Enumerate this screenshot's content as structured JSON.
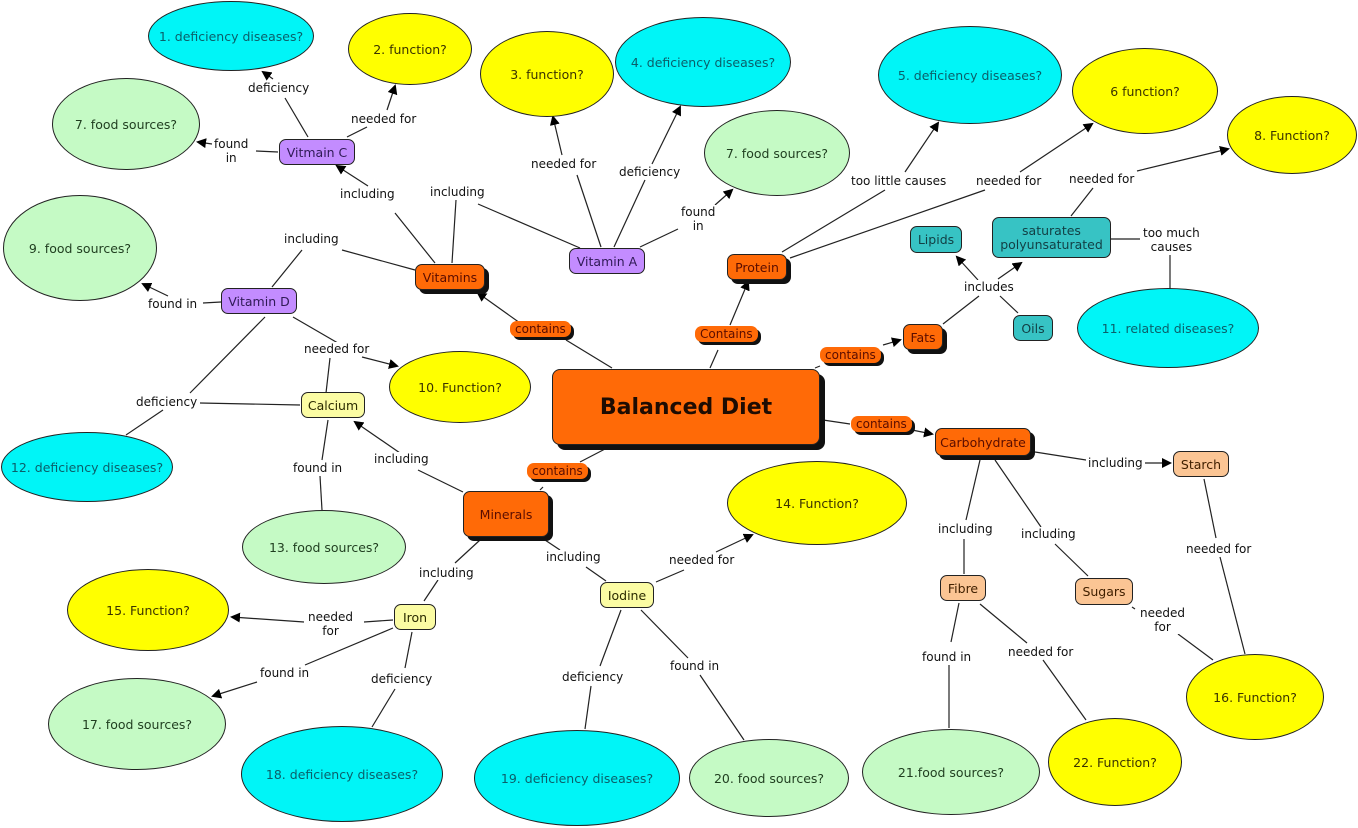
{
  "title": "Balanced Diet",
  "colors": {
    "orange": "#ff6a07",
    "purple": "#c38cff",
    "teal": "#37c3c4",
    "pale_yellow": "#fbfca3",
    "peach": "#fbc594",
    "cyan_question": "#00f5f7",
    "yellow_question": "#ffff00",
    "green_question": "#c5fac5"
  },
  "concepts": {
    "balanced_diet": "Balanced Diet",
    "vitamins": "Vitamins",
    "minerals": "Minerals",
    "protein": "Protein",
    "fats": "Fats",
    "carbohydrate": "Carbohydrate",
    "vitamin_c": "Vitmain C",
    "vitamin_a": "Vitamin A",
    "vitamin_d": "Vitamin D",
    "calcium": "Calcium",
    "iron": "Iron",
    "iodine": "Iodine",
    "lipids": "Lipids",
    "saturates": "saturates\npolyunsaturated",
    "oils": "Oils",
    "starch": "Starch",
    "fibre": "Fibre",
    "sugars": "Sugars"
  },
  "questions": {
    "q1": "1.  deficiency diseases?",
    "q2": "2.   function?",
    "q3": "3.   function?",
    "q4": "4. deficiency diseases?",
    "q7a": "7.   food sources?",
    "q7b": "7.   food sources?",
    "q5": "5.   deficiency diseases?",
    "q6": "6    function?",
    "q8": "8.   Function?",
    "q9": "9.  food sources?",
    "q10": "10.   Function?",
    "q11": "11.  related diseases?",
    "q12": "12.  deficiency diseases?",
    "q13": "13.  food sources?",
    "q14": "14.   Function?",
    "q15": "15.  Function?",
    "q16": "16.  Function?",
    "q17": "17.  food sources?",
    "q18": "18.   deficiency diseases?",
    "q19": "19.    deficiency diseases?",
    "q20": "20.   food sources?",
    "q21": "21.food sources?",
    "q22": "22.   Function?"
  },
  "link_labels": {
    "contains_vitamins": "contains",
    "contains_protein": "Contains",
    "contains_fats": "contains",
    "contains_carb": "contains",
    "contains_minerals": "contains",
    "vc_deficiency": "deficiency",
    "vc_needed": "needed for",
    "vc_found": "found\nin",
    "vit_incl_c": "including",
    "vit_incl_a": "including",
    "vit_incl_d": "including",
    "va_needed": "needed for",
    "va_deficiency": "deficiency",
    "va_found": "found\nin",
    "prot_too_little": "too little causes",
    "prot_needed": "needed for",
    "sat_needed": "needed for",
    "sat_too_much": "too much\ncauses",
    "fats_includes": "includes",
    "vd_found": "found in",
    "vd_needed": "needed for",
    "vd_deficiency": "deficiency",
    "calc_found": "found in",
    "min_incl_calc": "including",
    "min_incl_iron": "including",
    "min_incl_iodine": "including",
    "iodine_needed": "needed for",
    "iodine_deficiency": "deficiency",
    "iodine_found": "found in",
    "iron_needed": "needed\nfor",
    "iron_found": "found in",
    "iron_deficiency": "deficiency",
    "carb_incl_starch": "including",
    "carb_incl_fibre": "including",
    "carb_incl_sugars": "including",
    "starch_needed": "needed for",
    "sugars_needed": "needed\nfor",
    "fibre_found": "found in",
    "fibre_needed": "needed for"
  }
}
